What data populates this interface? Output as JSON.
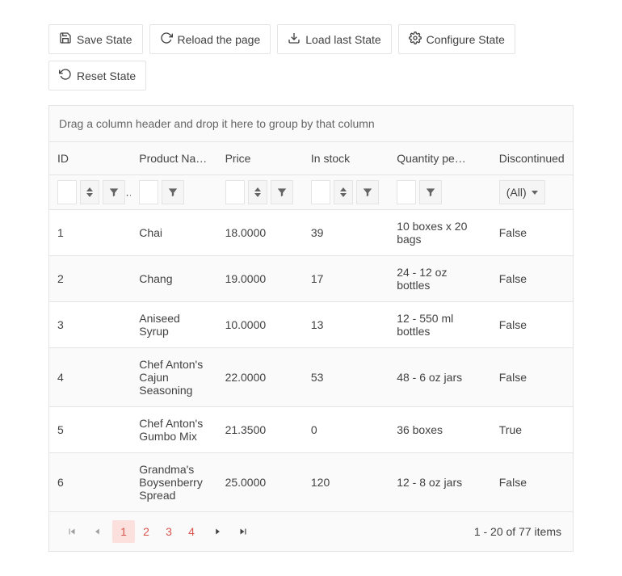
{
  "toolbar": {
    "save": "Save State",
    "reload": "Reload the page",
    "load": "Load last State",
    "configure": "Configure State",
    "reset": "Reset State"
  },
  "grid": {
    "group_panel": "Drag a column header and drop it here to group by that column",
    "columns": {
      "id": "ID",
      "name": "Product Na…",
      "price": "Price",
      "stock": "In stock",
      "qty": "Quantity pe…",
      "disc": "Discontinued"
    },
    "filter_all": "(All)",
    "rows": [
      {
        "id": "1",
        "name": "Chai",
        "price": "18.0000",
        "stock": "39",
        "qty": "10 boxes x 20 bags",
        "disc": "False"
      },
      {
        "id": "2",
        "name": "Chang",
        "price": "19.0000",
        "stock": "17",
        "qty": "24 - 12 oz bottles",
        "disc": "False"
      },
      {
        "id": "3",
        "name": "Aniseed Syrup",
        "price": "10.0000",
        "stock": "13",
        "qty": "12 - 550 ml bottles",
        "disc": "False"
      },
      {
        "id": "4",
        "name": "Chef Anton's Cajun Seasoning",
        "price": "22.0000",
        "stock": "53",
        "qty": "48 - 6 oz jars",
        "disc": "False"
      },
      {
        "id": "5",
        "name": "Chef Anton's Gumbo Mix",
        "price": "21.3500",
        "stock": "0",
        "qty": "36 boxes",
        "disc": "True"
      },
      {
        "id": "6",
        "name": "Grandma's Boysenberry Spread",
        "price": "25.0000",
        "stock": "120",
        "qty": "12 - 8 oz jars",
        "disc": "False"
      }
    ],
    "pager": {
      "pages": [
        "1",
        "2",
        "3",
        "4"
      ],
      "active": 0,
      "info": "1 - 20 of 77 items"
    }
  }
}
